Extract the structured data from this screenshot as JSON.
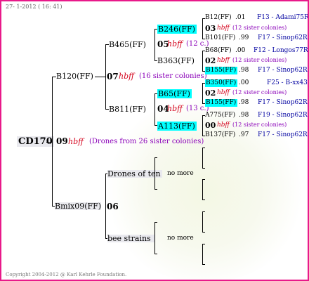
{
  "header": {
    "date_text": "27- 1-2012 ( 16: 41)"
  },
  "footer": {
    "copyright": "Copyright 2004-2012 @ Karl Kehrle Foundation."
  },
  "root": {
    "id": "CD170",
    "gen": "09",
    "code": "hbff",
    "note": "(Drones from 26 sister colonies)"
  },
  "g1": {
    "upper": {
      "name": "B120(FF)",
      "gen": "07",
      "code": "hbff",
      "note": "(16 sister colonies)"
    },
    "lower": {
      "name": "Bmix09(FF)",
      "gen": "06"
    }
  },
  "g2": {
    "a": {
      "name": "B465(FF)",
      "gen": "05",
      "code": "hbff",
      "note": "(12 c.)"
    },
    "b": {
      "name": "B811(FF)",
      "gen": "04",
      "code": "hbff",
      "note": "(13 c.)"
    },
    "c": {
      "name": "Drones of ten"
    },
    "d": {
      "name": "bee strains"
    }
  },
  "nomore": "no more",
  "g3": {
    "a1": "B246(FF)",
    "a2": "B363(FF)",
    "b1": "B65(FF)",
    "b2": "A113(FF)"
  },
  "g4": [
    {
      "name": "B12(FF)",
      "val": ".01",
      "src": "F13 - Adami75R"
    },
    {
      "gen": "03",
      "code": "hbff",
      "note": "(12 sister colonies)"
    },
    {
      "name": "B101(FF)",
      "val": ".99",
      "src": "F17 - Sinop62R"
    },
    {
      "name": "B68(FF)",
      "val": ".00",
      "src": "F12 - Longos77R"
    },
    {
      "gen": "02",
      "code": "hbff",
      "note": "(12 sister colonies)"
    },
    {
      "name": "B155(FF)",
      "val": ".98",
      "src": "F17 - Sinop62R"
    },
    {
      "name": "B350(FF)",
      "val": ".00",
      "src": "F25 - B-xx43"
    },
    {
      "gen": "02",
      "code": "hbff",
      "note": "(12 sister colonies)"
    },
    {
      "name": "B155(FF)",
      "val": ".98",
      "src": "F17 - Sinop62R"
    },
    {
      "name": "A775(FF)",
      "val": ".98",
      "src": "F19 - Sinop62R"
    },
    {
      "gen": "00",
      "code": "hbff",
      "note": "(12 sister colonies)"
    },
    {
      "name": "B137(FF)",
      "val": ".97",
      "src": "F17 - Sinop62R"
    }
  ]
}
